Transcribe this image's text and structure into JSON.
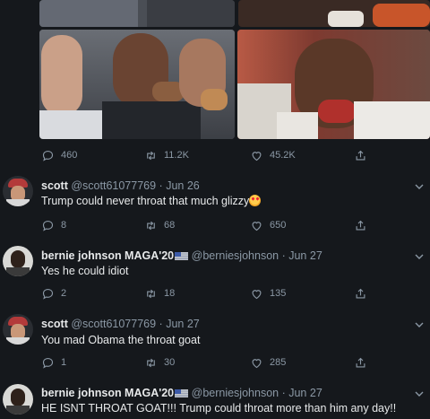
{
  "main_tweet": {
    "replies": "460",
    "retweets": "11.2K",
    "likes": "45.2K"
  },
  "replies": [
    {
      "display_name": "scott",
      "handle": "@scott61077769",
      "date": "Jun 26",
      "text": "Trump could never throat that much glizzy",
      "emoji": "smiling-face-with-heart-eyes",
      "replies": "8",
      "retweets": "68",
      "likes": "650"
    },
    {
      "display_name": "bernie johnson MAGA'20",
      "flag": "us-flag",
      "handle": "@berniesjohnson",
      "date": "Jun 27",
      "text": "Yes he could idiot",
      "replies": "2",
      "retweets": "18",
      "likes": "135"
    },
    {
      "display_name": "scott",
      "handle": "@scott61077769",
      "date": "Jun 27",
      "text": "You mad Obama the throat goat",
      "replies": "1",
      "retweets": "30",
      "likes": "285"
    },
    {
      "display_name": "bernie johnson MAGA'20",
      "flag": "us-flag",
      "handle": "@berniesjohnson",
      "date": "Jun 27",
      "text": "HE ISNT THROAT GOAT!!! Trump could throat more than him any day!!"
    }
  ],
  "colors": {
    "background": "#15181c",
    "text": "#e7e9ea",
    "muted": "#8b98a5"
  }
}
